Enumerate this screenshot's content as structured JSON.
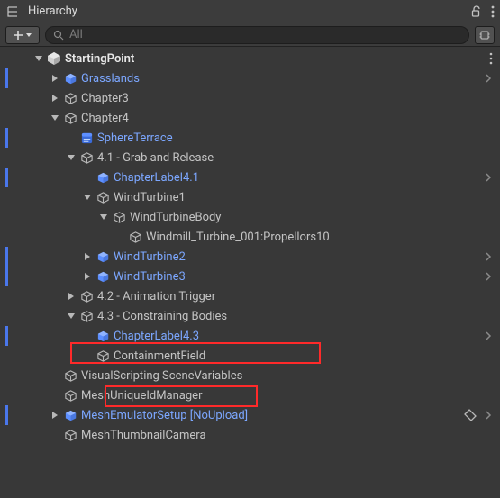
{
  "panel": {
    "title": "Hierarchy",
    "search_placeholder": "All"
  },
  "tree": {
    "root": "StartingPoint",
    "items": [
      {
        "id": "grasslands",
        "label": "Grasslands"
      },
      {
        "id": "chapter3",
        "label": "Chapter3"
      },
      {
        "id": "chapter4",
        "label": "Chapter4"
      },
      {
        "id": "sphereterrace",
        "label": "SphereTerrace"
      },
      {
        "id": "sec41",
        "label": "4.1 - Grab and Release"
      },
      {
        "id": "chlabel41",
        "label": "ChapterLabel4.1"
      },
      {
        "id": "windturbine1",
        "label": "WindTurbine1"
      },
      {
        "id": "windturbinebody",
        "label": "WindTurbineBody"
      },
      {
        "id": "windmillprop",
        "label": "Windmill_Turbine_001:Propellors10"
      },
      {
        "id": "windturbine2",
        "label": "WindTurbine2"
      },
      {
        "id": "windturbine3",
        "label": "WindTurbine3"
      },
      {
        "id": "sec42",
        "label": "4.2 - Animation Trigger"
      },
      {
        "id": "sec43",
        "label": "4.3 - Constraining Bodies"
      },
      {
        "id": "chlabel43",
        "label": "ChapterLabel4.3"
      },
      {
        "id": "containment",
        "label": "ContainmentField"
      },
      {
        "id": "visscript",
        "label": "VisualScripting SceneVariables"
      },
      {
        "id": "meshuid",
        "label": "MeshUniqueIdManager"
      },
      {
        "id": "meshemu",
        "label": "MeshEmulatorSetup [NoUpload]"
      },
      {
        "id": "meshthumb",
        "label": "MeshThumbnailCamera"
      }
    ]
  },
  "icons": {
    "hierarchy": "hierarchy-icon",
    "lock": "lock-icon",
    "menu": "menu-icon",
    "plus": "plus-icon",
    "search": "search-icon",
    "chip": "chip-icon",
    "unity": "unity-icon",
    "cube": "cube-icon",
    "prefab": "prefab-cube-icon",
    "script": "script-icon",
    "tag": "tag-icon"
  },
  "colors": {
    "accent_blue": "#7ca7ff",
    "guide_blue": "#4c7eff",
    "highlight_red": "#ff2a2a",
    "bg": "#383838"
  }
}
